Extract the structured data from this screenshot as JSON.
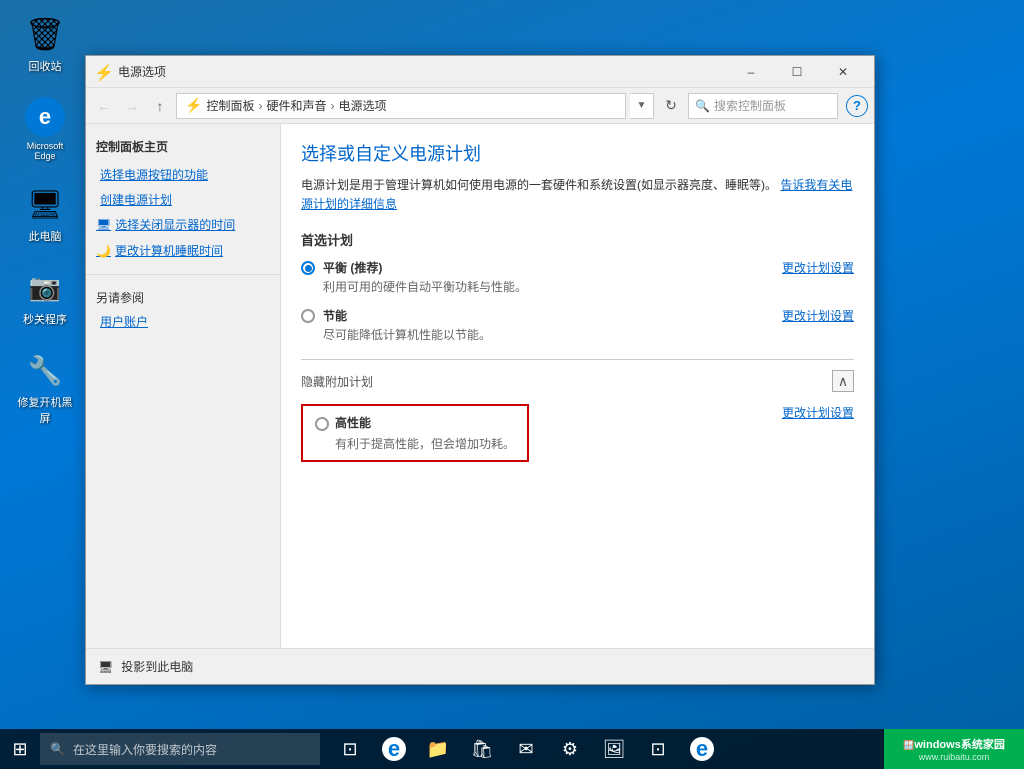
{
  "desktop": {
    "icons": [
      {
        "id": "recycle-bin",
        "label": "回收站",
        "symbol": "🗑"
      },
      {
        "id": "edge",
        "label": "Microsoft Edge",
        "symbol": "e"
      },
      {
        "id": "computer",
        "label": "此电脑",
        "symbol": "💻"
      },
      {
        "id": "screenshot",
        "label": "秒关程序",
        "symbol": "📷"
      },
      {
        "id": "repair",
        "label": "修复开机黑屏",
        "symbol": "🔧"
      }
    ]
  },
  "window": {
    "title": "电源选项",
    "breadcrumb": {
      "parts": [
        "控制面板",
        "硬件和声音",
        "电源选项"
      ]
    },
    "search_placeholder": "搜索控制面板",
    "help_label": "?",
    "sidebar": {
      "main_title": "控制面板主页",
      "links": [
        {
          "id": "power-button",
          "label": "选择电源按钮的功能"
        },
        {
          "id": "create-plan",
          "label": "创建电源计划"
        },
        {
          "id": "display-off",
          "label": "选择关闭显示器的时间",
          "has_icon": true
        },
        {
          "id": "sleep-time",
          "label": "更改计算机睡眠时间",
          "has_icon": true
        }
      ],
      "also_see": "另请参阅",
      "also_see_links": [
        {
          "id": "user-account",
          "label": "用户账户"
        }
      ]
    },
    "content": {
      "title": "选择或自定义电源计划",
      "description": "电源计划是用于管理计算机如何使用电源的一套硬件和系统设置(如显示器亮度、睡眠等)。",
      "description_link": "告诉我有关电源计划的详细信息",
      "preferred_label": "首选计划",
      "plans": [
        {
          "id": "balanced",
          "name": "平衡 (推荐)",
          "desc": "利用可用的硬件自动平衡功耗与性能。",
          "selected": true,
          "link": "更改计划设置"
        },
        {
          "id": "power-saver",
          "name": "节能",
          "desc": "尽可能降低计算机性能以节能。",
          "selected": false,
          "link": "更改计划设置"
        }
      ],
      "hidden_label": "隐藏附加计划",
      "hidden_plans": [
        {
          "id": "high-performance",
          "name": "高性能",
          "desc": "有利于提高性能，但会增加功耗。",
          "selected": false,
          "link": "更改计划设置"
        }
      ]
    },
    "bottom": {
      "icon": "🖥",
      "label": "投影到此电脑"
    }
  },
  "taskbar": {
    "start_icon": "⊞",
    "search_placeholder": "在这里输入你要搜索的内容",
    "icons": [
      {
        "id": "task-view",
        "symbol": "⊡"
      },
      {
        "id": "edge-taskbar",
        "symbol": "e"
      },
      {
        "id": "explorer",
        "symbol": "📁"
      },
      {
        "id": "store",
        "symbol": "🛍"
      },
      {
        "id": "mail",
        "symbol": "✉"
      },
      {
        "id": "settings",
        "symbol": "⚙"
      },
      {
        "id": "photos",
        "symbol": "🖼"
      },
      {
        "id": "device-manager",
        "symbol": "⊡"
      },
      {
        "id": "edge2",
        "symbol": "e"
      }
    ],
    "corner_brand": "windows系统家园",
    "corner_sub": "www.ruibaitu.com"
  }
}
